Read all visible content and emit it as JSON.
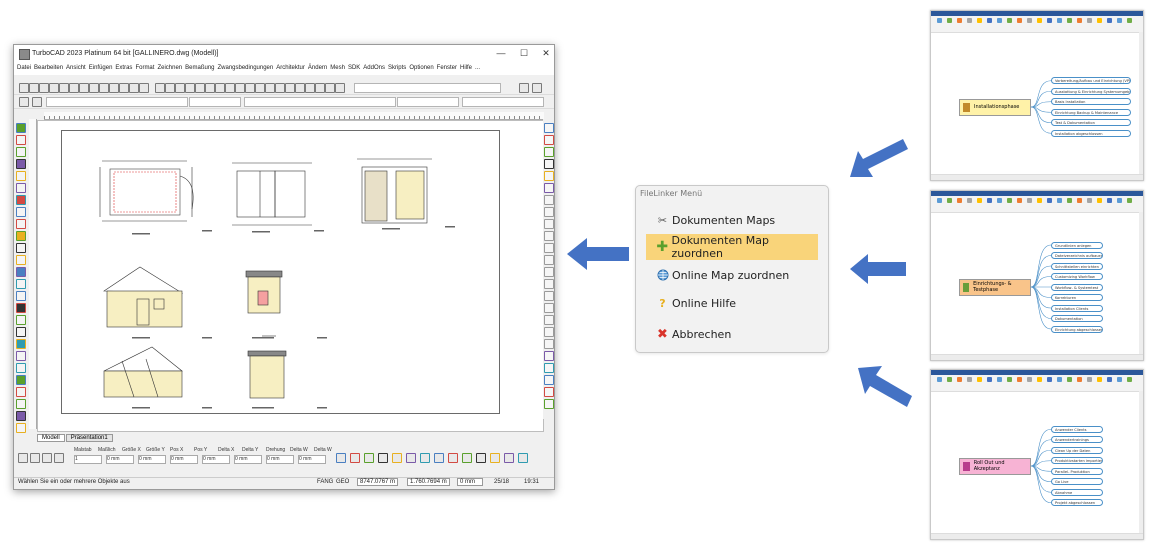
{
  "cad": {
    "title": "TurboCAD 2023 Platinum 64 bit   [GALLINERO.dwg (Modell)]",
    "window_buttons": [
      "—",
      "☐",
      "✕"
    ],
    "menu": [
      "Datei",
      "Bearbeiten",
      "Ansicht",
      "Einfügen",
      "Extras",
      "Format",
      "Zeichnen",
      "Bemaßung",
      "Zwangsbedingungen",
      "Architektur",
      "Ändern",
      "Mesh",
      "SDK",
      "AddOns",
      "Skripts",
      "Optionen",
      "Fenster",
      "Hilfe",
      "..."
    ],
    "tabs": [
      "Modell",
      "Präsentation1"
    ],
    "field_labels": [
      "Malstab",
      "Maßlich",
      "Größe X",
      "Größe Y",
      "Pos X",
      "Pos Y",
      "Delta X",
      "Delta Y",
      "Drehung",
      "Delta W",
      "Delta W"
    ],
    "field_values": [
      "1",
      "0 mm",
      "0 mm",
      "0 mm",
      "0 mm",
      "0 mm",
      "0 mm",
      "0 mm"
    ],
    "status_text": "Wählen Sie ein oder mehrere Objekte aus",
    "status_right": [
      "FANG",
      "GEO",
      "8747.0767 m",
      "1.760.7694 m",
      "0 mm",
      "25/18",
      "19:31"
    ]
  },
  "menu": {
    "title": "FileLinker Menü",
    "items": [
      {
        "label": "Dokumenten Maps",
        "icon": "tools-icon"
      },
      {
        "label": "Dokumenten Map zuordnen",
        "icon": "plus-icon",
        "highlighted": true
      },
      {
        "label": "Online Map zuordnen",
        "icon": "globe-icon"
      },
      {
        "label": "Online Hilfe",
        "icon": "question-icon"
      },
      {
        "label": "Abbrechen",
        "icon": "cross-icon"
      }
    ],
    "highlight_color": "#f9d47a"
  },
  "maps": [
    {
      "central": "Installationsphase",
      "central_color": "#fff2a8",
      "topics": [
        "Vorbereitung/Aufbau und Einrichtung (VPN)",
        "Ausstattung & Einrichtung Systemumgebung",
        "Basis Installation",
        "Einrichtung Backup & Maintenance",
        "Test & Dokumentation",
        "Installation abgeschlossen"
      ]
    },
    {
      "central": "Einrichtungs- & Testphase",
      "central_color": "#f9c48a",
      "topics": [
        "Grundlinien anlegen",
        "Dateiverzeichnis aufbauen",
        "Schnittstellen einrichten",
        "Customizing Workflow",
        "Workflow- & Systemtest",
        "Korrekturen",
        "Installation Clients",
        "Dokumentation",
        "Einrichtung abgeschlossen"
      ]
    },
    {
      "central": "Roll Out und Akzeptanz",
      "central_color": "#f7b3d4",
      "topics": [
        "Anwender Clients",
        "Anwendertrainings",
        "Clean Up der Daten",
        "Produktivstarten importieren",
        "Parallel- Produktion",
        "Go Live",
        "Abnahme",
        "Projekt abgeschlossen"
      ]
    }
  ],
  "colors": {
    "arrow": "#4472c4",
    "topic_border": "#4a90c8"
  }
}
